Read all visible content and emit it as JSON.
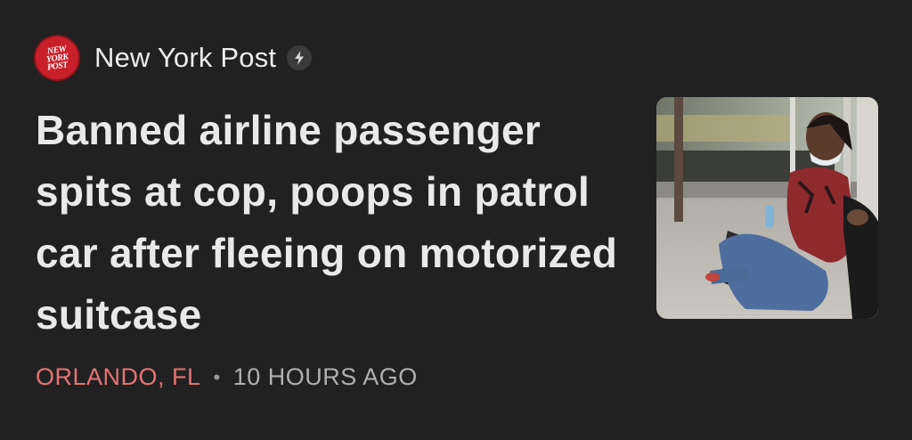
{
  "source": {
    "logo_lines": [
      "NEW",
      "YORK",
      "POST"
    ],
    "name": "New York Post",
    "logo_color": "#c8202a"
  },
  "article": {
    "headline": "Banned airline passenger spits at cop, poops in patrol car after fleeing on motorized suitcase",
    "location": "ORLANDO, FL",
    "separator": "•",
    "time": "10 HOURS AGO"
  },
  "colors": {
    "background": "#212121",
    "location": "#e57373",
    "time": "#b0b0b0"
  },
  "icons": {
    "publisher_badge": "lightning-bolt-icon"
  }
}
